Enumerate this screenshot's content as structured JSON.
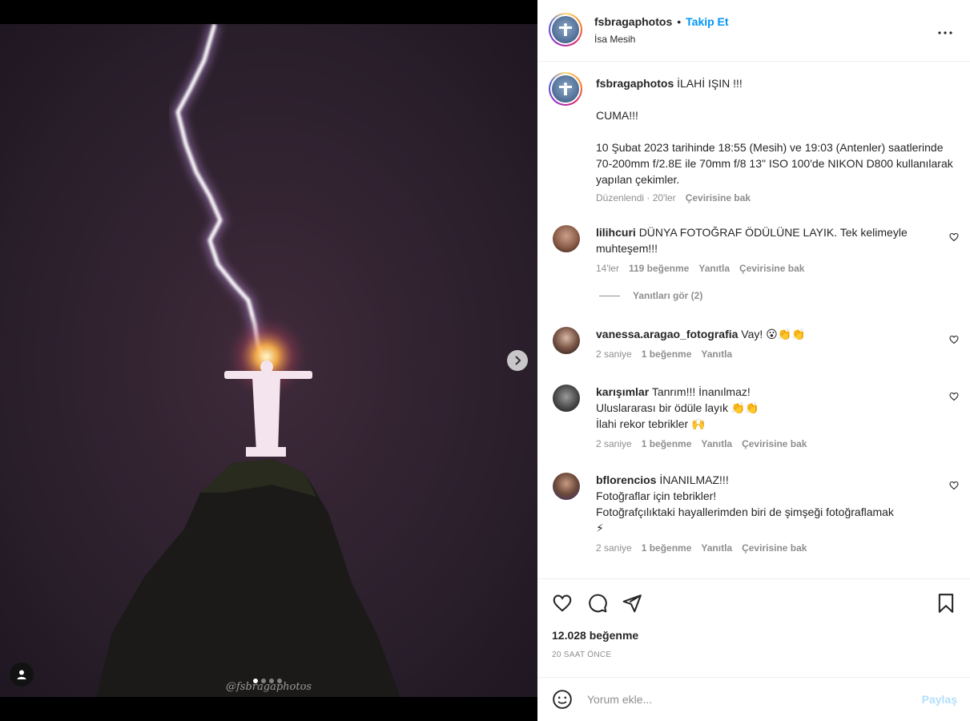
{
  "post": {
    "username": "fsbragaphotos",
    "separator": "•",
    "follow_label": "Takip Et",
    "location": "İsa Mesih",
    "watermark": "@fsbragaphotos",
    "carousel": {
      "count": 4,
      "active_index": 0
    }
  },
  "caption": {
    "username": "fsbragaphotos",
    "title": "İLAHİ IŞIN !!!",
    "line2": "CUMA!!!",
    "body": "10 Şubat 2023 tarihinde 18:55 (Mesih) ve 19:03 (Antenler) saatlerinde 70-200mm f/2.8E ile 70mm f/8 13\" ISO 100'de NIKON D800 kullanılarak yapılan çekimler.",
    "edited": "Düzenlendi · 20'ler",
    "translate": "Çevirisine bak"
  },
  "comments": [
    {
      "username": "lilihcuri",
      "text": "DÜNYA FOTOĞRAF ÖDÜLÜNE LAYIK. Tek kelimeyle muhteşem!!!",
      "time": "14'ler",
      "likes": "119 beğenme",
      "reply": "Yanıtla",
      "translate": "Çevirisine bak",
      "view_replies": "Yanıtları gör (2)"
    },
    {
      "username": "vanessa.aragao_fotografia",
      "text": "Vay! 😮👏👏",
      "time": "2 saniye",
      "likes": "1 beğenme",
      "reply": "Yanıtla"
    },
    {
      "username": "karışımlar",
      "line1": "Tanrım!!! İnanılmaz!",
      "line2": "Uluslararası bir ödüle layık 👏👏",
      "line3": "İlahi rekor tebrikler 🙌",
      "time": "2 saniye",
      "likes": "1 beğenme",
      "reply": "Yanıtla",
      "translate": "Çevirisine bak"
    },
    {
      "username": "bflorencios",
      "line1": "İNANILMAZ!!!",
      "line2": "Fotoğraflar için tebrikler!",
      "line3": "Fotoğrafçılıktaki hayallerimden biri de şimşeği fotoğraflamak",
      "line4": "⚡",
      "time": "2 saniye",
      "likes": "1 beğenme",
      "reply": "Yanıtla",
      "translate": "Çevirisine bak"
    }
  ],
  "stats": {
    "likes": "12.028 beğenme",
    "time_ago": "20 SAAT ÖNCE"
  },
  "comment_box": {
    "placeholder": "Yorum ekle...",
    "share_label": "Paylaş"
  },
  "colors": {
    "accent": "#0095f6",
    "share_disabled": "#b2dffc",
    "meta": "#8e8e8e"
  },
  "icons": {
    "more": "more-options-icon",
    "like": "heart-icon",
    "comment": "comment-icon",
    "share": "send-icon",
    "save": "bookmark-icon",
    "emoji": "emoji-icon",
    "next": "chevron-right-icon",
    "tags": "user-tag-icon"
  }
}
